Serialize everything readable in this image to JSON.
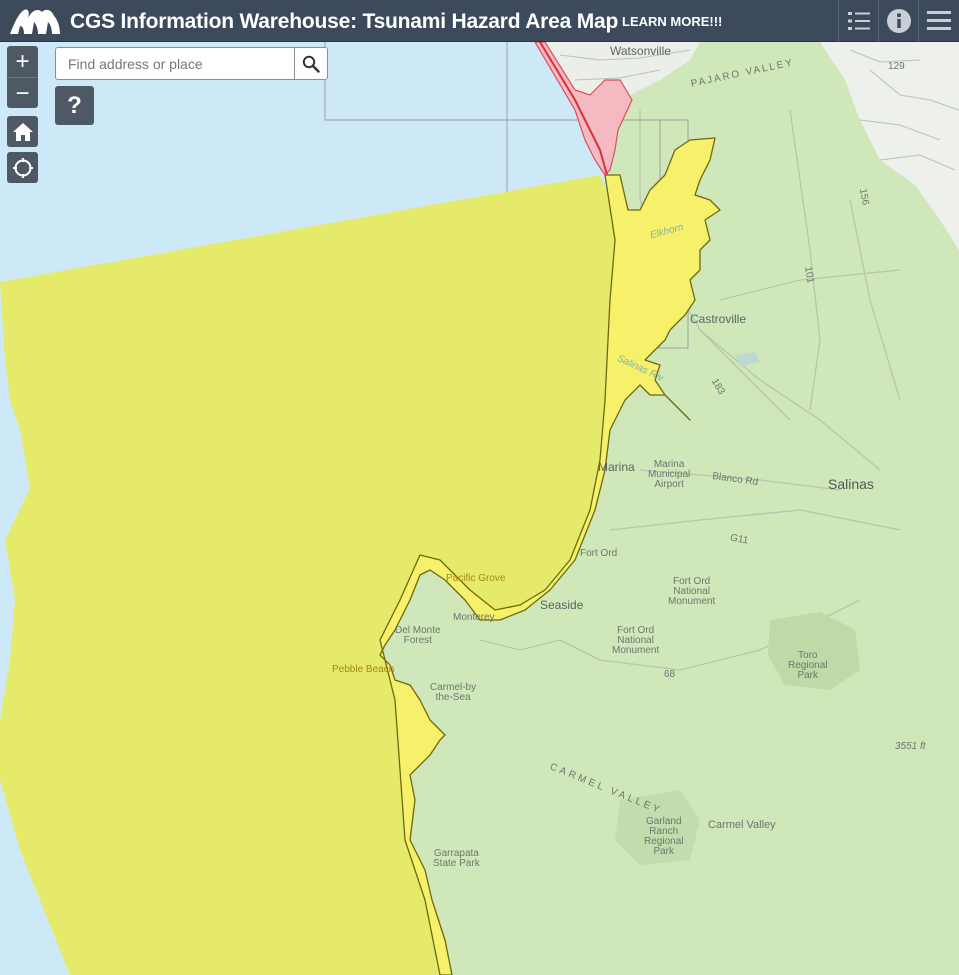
{
  "header": {
    "title": "CGS Information Warehouse: Tsunami Hazard Area Map",
    "learn_more": "LEARN MORE!!!",
    "buttons": [
      "legend-icon",
      "info-icon",
      "menu-icon"
    ]
  },
  "controls": {
    "zoom_in": "+",
    "zoom_out": "−",
    "help": "?",
    "search_placeholder": "Find address or place"
  },
  "colors": {
    "header": "#3d4a5c",
    "ocean": "#cde9f7",
    "tsunami_hazard_ocean": "#e5ea6a",
    "tsunami_hazard_land": "#f6f06a",
    "hazard_outline": "#6b6a10",
    "land_green": "#cfe7b9",
    "pink_area": "#f4b9c1"
  },
  "labels": {
    "watsonville": "Watsonville",
    "pajaro_valley": "PAJARO VALLEY",
    "castroville": "Castroville",
    "elkhorn": "Elkhorn",
    "salinas_river": "Salinas Riv",
    "marina": "Marina",
    "marina_airport": [
      "Marina",
      "Municipal",
      "Airport"
    ],
    "blanco_rd": "Blanco Rd",
    "salinas": "Salinas",
    "g11": "G11",
    "fort_ord": "Fort Ord",
    "fort_ord_nm_1": [
      "Fort Ord",
      "National",
      "Monument"
    ],
    "fort_ord_nm_2": [
      "Fort Ord",
      "National",
      "Monument"
    ],
    "pacific_grove": "Pacific Grove",
    "seaside": "Seaside",
    "monterey": "Monterey",
    "del_monte_forest": [
      "Del Monte",
      "Forest"
    ],
    "pebble_beach": "Pebble Beach",
    "carmel": [
      "Carmel-by",
      "the-Sea"
    ],
    "toro_park": [
      "Toro",
      "Regional",
      "Park"
    ],
    "carmel_valley_region": "CARMEL VALLEY",
    "elevation": "3551 ft",
    "garland_park": [
      "Garland",
      "Ranch",
      "Regional",
      "Park"
    ],
    "carmel_valley_town": "Carmel Valley",
    "garrapata_park": [
      "Garrapata",
      "State Park"
    ],
    "r68": "68",
    "r101": "101",
    "r183": "183",
    "r156": "156",
    "r129": "129"
  }
}
